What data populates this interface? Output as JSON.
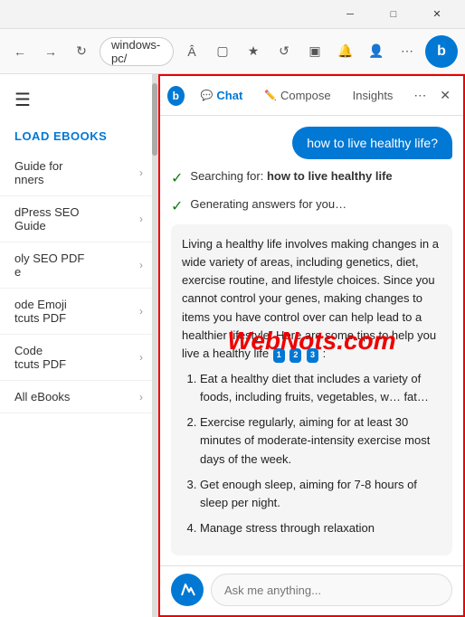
{
  "titlebar": {
    "minimize_label": "─",
    "maximize_label": "□",
    "close_label": "✕"
  },
  "browser": {
    "address": "windows-pc/",
    "bing_letter": "b"
  },
  "panel": {
    "logo_letter": "b",
    "tabs": [
      {
        "id": "chat",
        "label": "Chat",
        "icon": "💬",
        "active": true
      },
      {
        "id": "compose",
        "label": "Compose",
        "icon": "✏️",
        "active": false
      },
      {
        "id": "insights",
        "label": "Insights",
        "active": false
      }
    ],
    "more_icon": "⋯",
    "close_icon": "✕"
  },
  "chat": {
    "user_message": "how to live healthy life?",
    "status1_text": "Searching for: ",
    "status1_bold": "how to live healthy life",
    "status2_text": "Generating answers for you…",
    "answer_intro": "Living a healthy life involves making changes in a wide variety of areas, including genetics, diet, exercise routine, and lifestyle choices. Since you cannot control your genes, making changes to items you have control over can help lead to a healthier lifestyle. Here are some tips to help you live a healthy life",
    "refs": [
      "1",
      "2",
      "3"
    ],
    "tips": [
      "Eat a healthy diet that includes a variety of foods, including fruits, vegetables, w… fat…",
      "Exercise regularly, aiming for at least 30 minutes of moderate-intensity exercise most days of the week.",
      "Get enough sleep, aiming for 7-8 hours of sleep per night.",
      "Manage stress through relaxation"
    ]
  },
  "sidebar": {
    "section_title": "LOAD EBOOKS",
    "items": [
      {
        "label": "Guide for\nners"
      },
      {
        "label": "dPress SEO\nGuide"
      },
      {
        "label": "oly SEO PDF\ne"
      },
      {
        "label": "ode Emoji\ntcuts PDF"
      },
      {
        "label": "Code\ntcuts PDF"
      },
      {
        "label": "All eBooks"
      }
    ]
  },
  "input": {
    "placeholder": "Ask me anything...",
    "icon": "🔵"
  },
  "watermark": {
    "text_before": "Web",
    "text_red": "Nots",
    "text_after": ".com"
  }
}
